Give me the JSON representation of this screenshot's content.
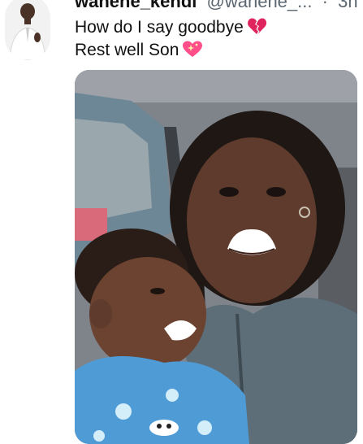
{
  "tweet": {
    "display_name": "wahene_kendi",
    "handle": "@wahene_...",
    "separator": "·",
    "timestamp": "3h",
    "text_line1": "How do I say goodbye",
    "text_line2": "Rest well Son",
    "emoji1": "broken-heart-icon",
    "emoji2": "sparkling-heart-icon"
  },
  "colors": {
    "text": "#111111",
    "secondary": "#5b6670",
    "emoji": "#e0245e"
  }
}
